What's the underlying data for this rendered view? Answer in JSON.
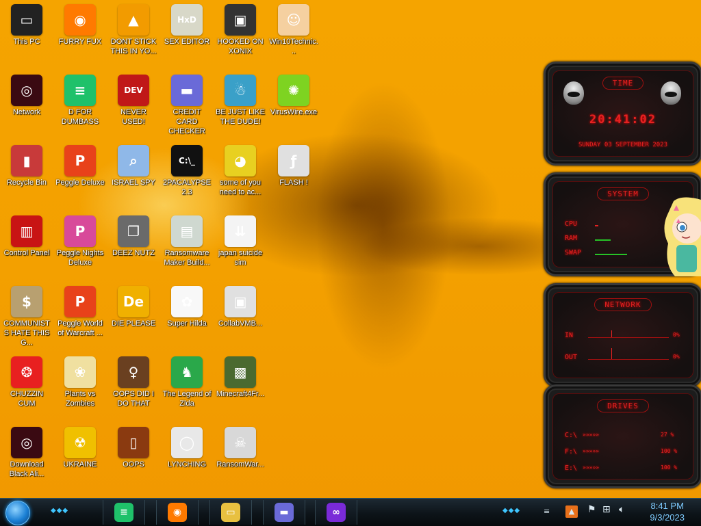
{
  "desktop": {
    "icons": [
      {
        "label": "This PC",
        "icon": "computer-icon",
        "color": "#222222",
        "glyph": "▭"
      },
      {
        "label": "FURRY FUX",
        "icon": "firefox-icon",
        "color": "#ff7a00",
        "glyph": "◉"
      },
      {
        "label": "DONT STICK THIS IN YO...",
        "icon": "vlc-cone-icon",
        "color": "#f29b00",
        "glyph": "▲"
      },
      {
        "label": "SEX EDITOR",
        "icon": "hxd-icon",
        "color": "#d8d8c8",
        "glyph": "HxD"
      },
      {
        "label": "HOOKED ON XONIX",
        "icon": "xonix-icon",
        "color": "#333333",
        "glyph": "▣"
      },
      {
        "label": "Win10Technic...",
        "icon": "technician-icon",
        "color": "#f5d0a0",
        "glyph": "☺"
      },
      {
        "label": "Network",
        "icon": "network-icon",
        "color": "#3a0a12",
        "glyph": "◎"
      },
      {
        "label": "D FOR DUMBASS",
        "icon": "chat-icon",
        "color": "#1fc16a",
        "glyph": "≡"
      },
      {
        "label": "NEVER USED!",
        "icon": "devcpp-icon",
        "color": "#c01818",
        "glyph": "DEV"
      },
      {
        "label": "CREDIT CARD CHECKER",
        "icon": "credit-card-icon",
        "color": "#6a6ad8",
        "glyph": "▬"
      },
      {
        "label": "BE JUST LIKE THE DUDE!",
        "icon": "santa-icon",
        "color": "#3aa0c8",
        "glyph": "☃"
      },
      {
        "label": "VirusWire.exe",
        "icon": "lime-icon",
        "color": "#7ed321",
        "glyph": "✺"
      },
      {
        "label": "Recycle Bin",
        "icon": "recycle-bin-icon",
        "color": "#c83a3a",
        "glyph": "▮"
      },
      {
        "label": "Peggle Deluxe",
        "icon": "peggle-icon",
        "color": "#e8421a",
        "glyph": "P"
      },
      {
        "label": "ISRAEL SPY",
        "icon": "spy-icon",
        "color": "#8fb8e8",
        "glyph": "⌕"
      },
      {
        "label": "2PACALYPSE 2.3",
        "icon": "terminal-icon",
        "color": "#111111",
        "glyph": "C:\\_"
      },
      {
        "label": "some of you need to ac...",
        "icon": "dog-icon",
        "color": "#e8d020",
        "glyph": "◕"
      },
      {
        "label": "FLASH !",
        "icon": "flash-icon",
        "color": "#e0e0e0",
        "glyph": "ƒ"
      },
      {
        "label": "Control Panel",
        "icon": "control-panel-icon",
        "color": "#c81414",
        "glyph": "▥"
      },
      {
        "label": "Peggle Nights Deluxe",
        "icon": "peggle-nights-icon",
        "color": "#d84a9a",
        "glyph": "P"
      },
      {
        "label": "DEEZ NUTZ",
        "icon": "windows-stack-icon",
        "color": "#6a6a6a",
        "glyph": "❐"
      },
      {
        "label": "Ransomware Maker Build...",
        "icon": "window-app-icon",
        "color": "#cfd8d0",
        "glyph": "▤"
      },
      {
        "label": "japan suicide sim",
        "icon": "japan-icon",
        "color": "#f4f4f4",
        "glyph": "⇊"
      },
      {
        "label": "",
        "icon": "",
        "color": "",
        "glyph": ""
      },
      {
        "label": "COMMUNISTS HATE THIS G...",
        "icon": "money-bag-icon",
        "color": "#b8a070",
        "glyph": "$"
      },
      {
        "label": "Peggle World of Warcraft ...",
        "icon": "peggle-wow-icon",
        "color": "#e8421a",
        "glyph": "P"
      },
      {
        "label": "DIE PLEASE",
        "icon": "de-icon",
        "color": "#f0b000",
        "glyph": "De"
      },
      {
        "label": "Super Hilda",
        "icon": "hilda-icon",
        "color": "#f8f8f8",
        "glyph": "✿"
      },
      {
        "label": "CollabVMB...",
        "icon": "collabvm-icon",
        "color": "#e0e0e0",
        "glyph": "▣"
      },
      {
        "label": "",
        "icon": "",
        "color": "",
        "glyph": ""
      },
      {
        "label": "CHUZZIN CUM",
        "icon": "chuzzle-icon",
        "color": "#e82020",
        "glyph": "❂"
      },
      {
        "label": "Plants vs Zombies",
        "icon": "pvz-icon",
        "color": "#f0e0a0",
        "glyph": "❀"
      },
      {
        "label": "OOPS DID I DO THAT",
        "icon": "portrait-icon",
        "color": "#6a4020",
        "glyph": "♀"
      },
      {
        "label": "The Legend of Zlda",
        "icon": "zelda-icon",
        "color": "#2aa84a",
        "glyph": "♞"
      },
      {
        "label": "Minecraft4Fr...",
        "icon": "minecraft-icon",
        "color": "#4a6a30",
        "glyph": "▩"
      },
      {
        "label": "",
        "icon": "",
        "color": "",
        "glyph": ""
      },
      {
        "label": "Download Black Ali...",
        "icon": "black-alien-icon",
        "color": "#3a0a12",
        "glyph": "◎"
      },
      {
        "label": "UKRAINE",
        "icon": "radiation-icon",
        "color": "#f0c000",
        "glyph": "☢"
      },
      {
        "label": "OOPS",
        "icon": "book-icon",
        "color": "#8a3a10",
        "glyph": "▯"
      },
      {
        "label": "LYNCHING",
        "icon": "noose-icon",
        "color": "#e8e8e8",
        "glyph": "◯"
      },
      {
        "label": "RansomWar...",
        "icon": "skull-icon",
        "color": "#d8d8d8",
        "glyph": "☠"
      },
      {
        "label": "",
        "icon": "",
        "color": "",
        "glyph": ""
      }
    ]
  },
  "gadgets": {
    "time": {
      "title": "TIME",
      "clock": "20:41:02",
      "date": "SUNDAY 03 SEPTEMBER 2023"
    },
    "system": {
      "title": "SYSTEM",
      "cpu_label": "CPU",
      "ram_label": "RAM",
      "swap_label": "SWAP",
      "cpu": 0.05,
      "ram": 0.25,
      "swap": 0.52
    },
    "network": {
      "title": "NETWORK",
      "in_label": "IN",
      "out_label": "OUT",
      "in_value": "0%",
      "out_value": "0%"
    },
    "drives": {
      "title": "DRIVES",
      "items": [
        {
          "label": "C:\\",
          "value": "27 %"
        },
        {
          "label": "F:\\",
          "value": "100 %"
        },
        {
          "label": "E:\\",
          "value": "100 %"
        }
      ]
    }
  },
  "taskbar": {
    "apps": [
      {
        "name": "chat-app",
        "icon": "chat-icon",
        "color": "#1fc16a",
        "glyph": "≡"
      },
      {
        "name": "firefox",
        "icon": "firefox-icon",
        "color": "#ff7a00",
        "glyph": "◉"
      },
      {
        "name": "file-explorer",
        "icon": "folder-icon",
        "color": "#e8c040",
        "glyph": "▭"
      },
      {
        "name": "credit-card-checker",
        "icon": "credit-card-icon",
        "color": "#6a6ad8",
        "glyph": "▬"
      },
      {
        "name": "mask-app",
        "icon": "mask-icon",
        "color": "#7a2ad8",
        "glyph": "∞"
      }
    ],
    "time": "8:41 PM",
    "date": "9/3/2023"
  }
}
